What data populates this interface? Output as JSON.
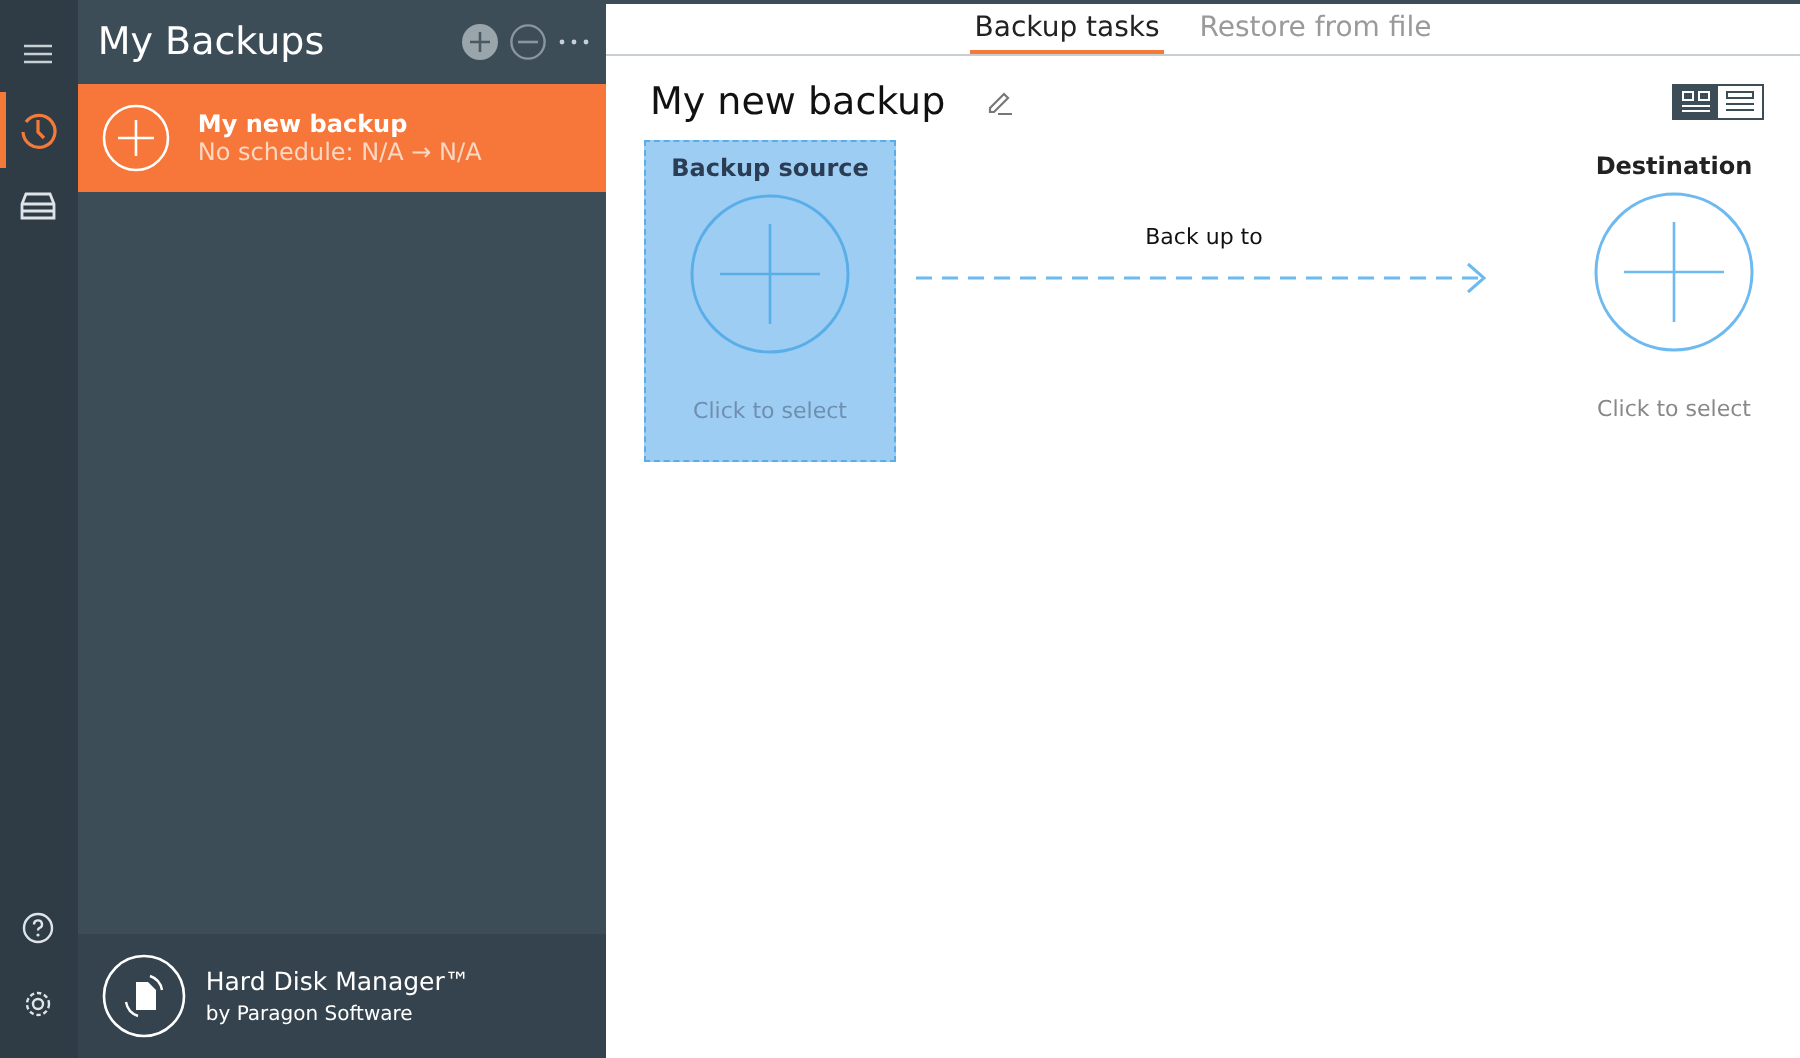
{
  "rail": [
    {
      "kind": "menu",
      "selected": false
    },
    {
      "kind": "history",
      "selected": true
    },
    {
      "kind": "drive",
      "selected": false
    }
  ],
  "rail_bottom": [
    {
      "kind": "help"
    },
    {
      "kind": "settings"
    }
  ],
  "sidebar": {
    "title": "My Backups",
    "backups": [
      {
        "name": "My new backup",
        "schedule": "No schedule: N/A → N/A",
        "selected": true
      }
    ],
    "product": "Hard Disk Manager™",
    "vendor": "by Paragon Software"
  },
  "tabs": [
    {
      "label": "Backup tasks",
      "selected": true
    },
    {
      "label": "Restore from file",
      "selected": false
    }
  ],
  "task": {
    "title": "My new backup"
  },
  "views": [
    {
      "kind": "tiles",
      "selected": true
    },
    {
      "kind": "list",
      "selected": false
    }
  ],
  "source": {
    "title": "Backup source",
    "hint": "Click to select",
    "selected": true
  },
  "link_label": "Back up to",
  "destination": {
    "title": "Destination",
    "hint": "Click to select",
    "selected": false
  }
}
